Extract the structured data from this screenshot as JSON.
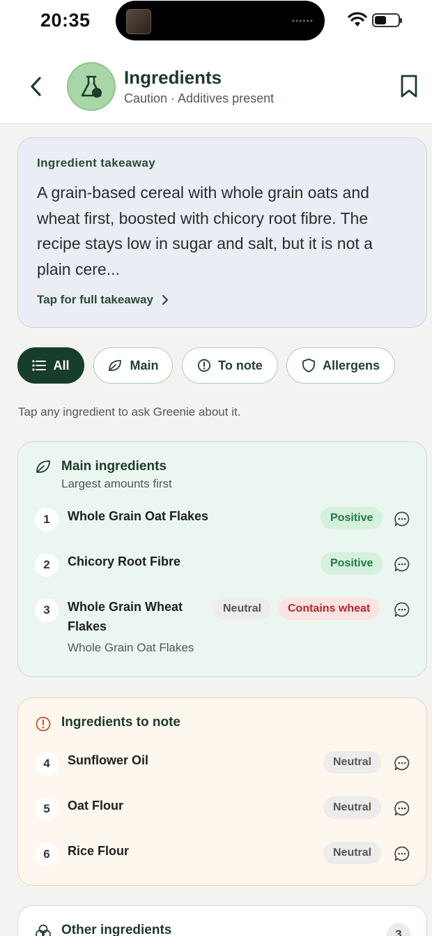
{
  "status_bar": {
    "time": "20:35"
  },
  "header": {
    "title": "Ingredients",
    "subtitle": "Caution · Additives present"
  },
  "takeaway": {
    "label": "Ingredient takeaway",
    "text": "A grain-based cereal with whole grain oats and wheat first, boosted with chicory root fibre. The recipe stays low in sugar and salt, but it is not a plain cere...",
    "link": "Tap for full takeaway"
  },
  "filters": [
    {
      "label": "All",
      "icon": "list-icon",
      "active": true
    },
    {
      "label": "Main",
      "icon": "leaf-icon",
      "active": false
    },
    {
      "label": "To note",
      "icon": "alert-circle-icon",
      "active": false
    },
    {
      "label": "Allergens",
      "icon": "shield-icon",
      "active": false
    }
  ],
  "hint": "Tap any ingredient to ask Greenie about it.",
  "main_section": {
    "title": "Main ingredients",
    "subtitle": "Largest amounts first",
    "items": [
      {
        "num": "1",
        "name": "Whole Grain Oat Flakes",
        "badges": [
          "Positive"
        ]
      },
      {
        "num": "2",
        "name": "Chicory Root Fibre",
        "badges": [
          "Positive"
        ]
      },
      {
        "num": "3",
        "name_line1": "Whole Grain Wheat",
        "name_line2": "Flakes",
        "sub": "Whole Grain Oat Flakes",
        "badges": [
          "Neutral",
          "Contains wheat"
        ]
      }
    ]
  },
  "note_section": {
    "title": "Ingredients to note",
    "items": [
      {
        "num": "4",
        "name": "Sunflower Oil",
        "badge": "Neutral"
      },
      {
        "num": "5",
        "name": "Oat Flour",
        "badge": "Neutral"
      },
      {
        "num": "6",
        "name": "Rice Flour",
        "badge": "Neutral"
      }
    ]
  },
  "other_section": {
    "title": "Other ingredients",
    "count": "3"
  },
  "colors": {
    "brand_dark": "#173d2b",
    "positive": "#1f7a45",
    "allergen": "#b02a2a",
    "caution": "#c0552a"
  }
}
